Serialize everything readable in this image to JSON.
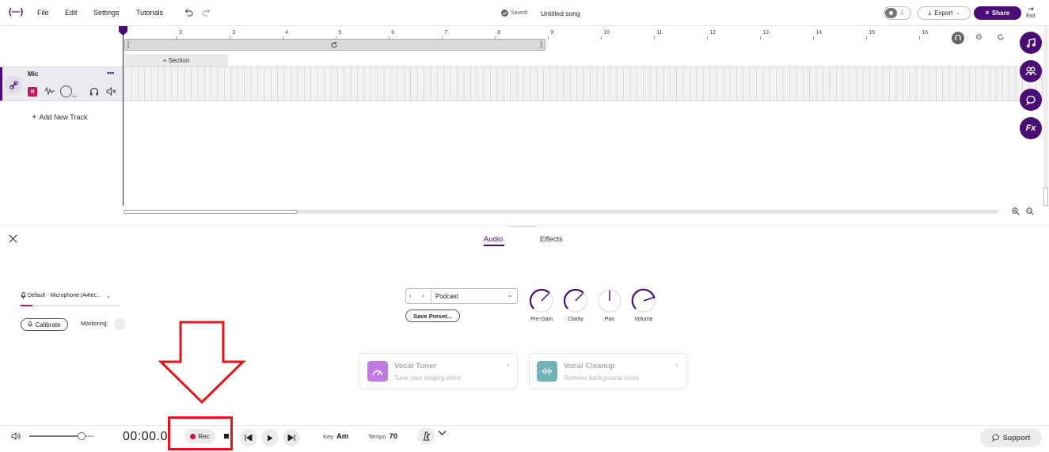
{
  "app": {
    "logo": "(—)",
    "saved_text": "Saved!",
    "song_title": "Untitled song"
  },
  "menu": [
    "File",
    "Edit",
    "Settings",
    "Tutorials"
  ],
  "header": {
    "export_label": "Export",
    "share_label": "Share",
    "exit_label": "Exit"
  },
  "ruler": {
    "ticks": [
      "2",
      "3",
      "4",
      "5",
      "6",
      "7",
      "8",
      "9",
      "10",
      "11",
      "12",
      "13",
      "14",
      "15",
      "16"
    ]
  },
  "section": {
    "add_label": "+ Section"
  },
  "track": {
    "name": "Mic",
    "record_badge": "R",
    "more": "•••"
  },
  "add_track": {
    "label": "Add New Track"
  },
  "panel": {
    "tabs": [
      "Audio",
      "Effects"
    ],
    "active_tab": "Audio",
    "input_device": "Default - Microphone (A4tec...",
    "calibrate_label": "Calibrate",
    "monitoring_label": "Monitoring:",
    "preset": {
      "value": "Podcast",
      "save_label": "Save Preset..."
    },
    "knobs": [
      {
        "label": "Pre-Gain"
      },
      {
        "label": "Clarity"
      },
      {
        "label": "Pan"
      },
      {
        "label": "Volume"
      }
    ],
    "cards": [
      {
        "title": "Vocal Tuner",
        "subtitle": "Tune your singing voice"
      },
      {
        "title": "Vocal Cleanup",
        "subtitle": "Remove background noise"
      }
    ]
  },
  "transport": {
    "time": "00:00.0",
    "rec_label": "Rec",
    "key_label": "Key",
    "key_value": "Am",
    "tempo_label": "Tempo",
    "tempo_value": "70",
    "support_label": "Support",
    "volume_level": 0.8
  },
  "colors": {
    "brand": "#4a0d75",
    "rec": "#c2185b",
    "annotation": "#e0161b",
    "tuner": "#c07be0",
    "cleanup": "#6fb3b8"
  },
  "icons": [
    "undo-icon",
    "redo-icon",
    "check-circle-icon",
    "theme-toggle-icon",
    "export-icon",
    "share-icon",
    "exit-icon",
    "loop-icon",
    "link-icon",
    "waveform-icon",
    "headphones-icon",
    "mute-icon",
    "close-icon",
    "microphone-icon",
    "music-note-icon",
    "collab-icon",
    "chat-icon",
    "fx-icon",
    "zoom-in-icon",
    "zoom-out-icon",
    "speaker-icon",
    "stop-icon",
    "rewind-icon",
    "play-icon",
    "forward-icon",
    "metronome-icon",
    "chevron-down-icon",
    "support-chat-icon",
    "settings-icon"
  ]
}
